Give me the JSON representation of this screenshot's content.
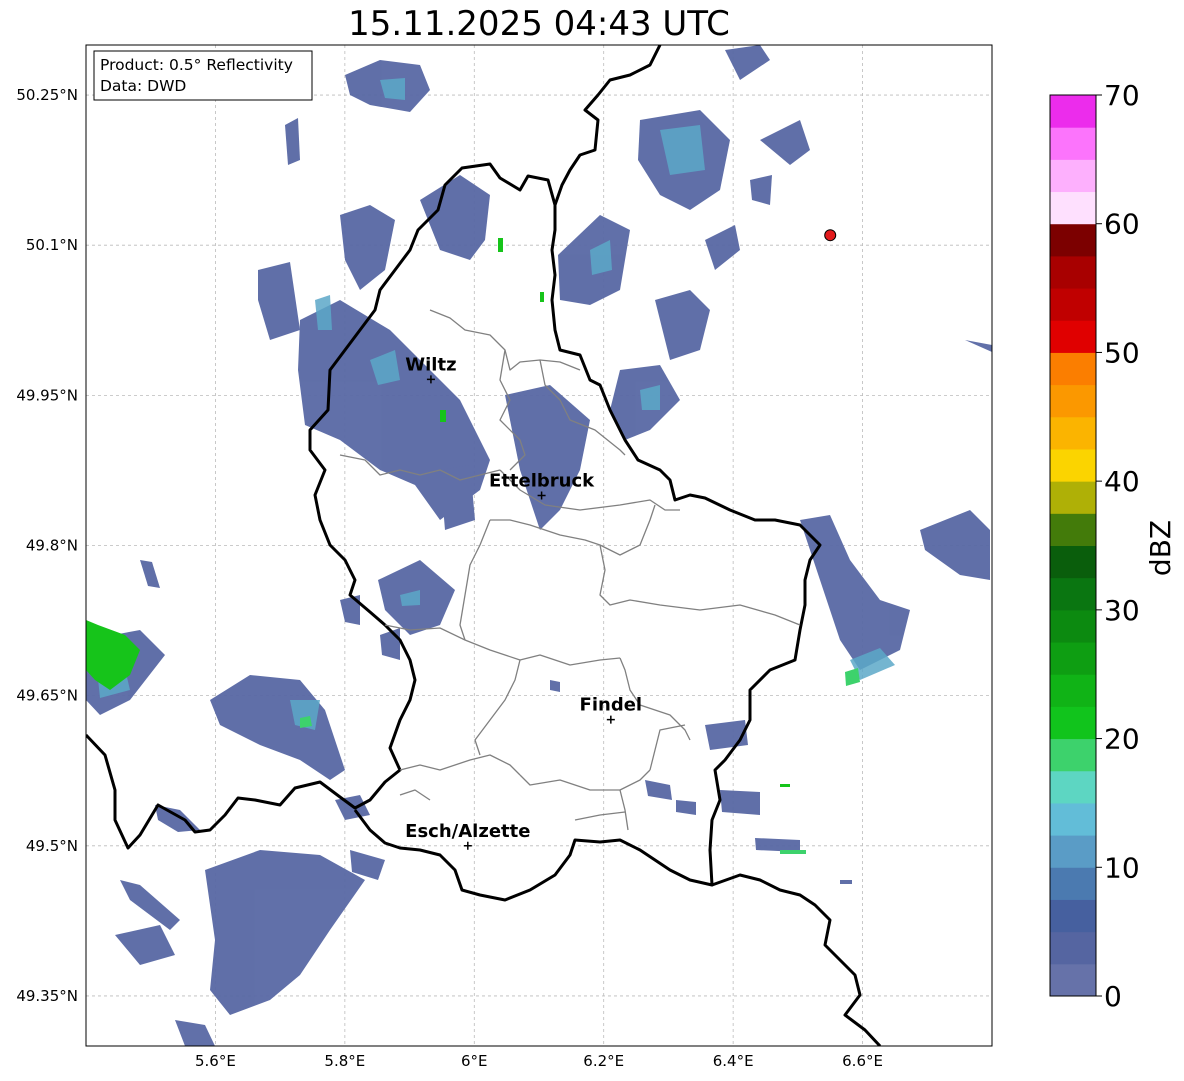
{
  "title": "15.11.2025 04:43 UTC",
  "info_box": {
    "line1": "Product: 0.5° Reflectivity",
    "line2": "Data: DWD"
  },
  "axes": {
    "lon_ticks": [
      "5.6°E",
      "5.8°E",
      "6°E",
      "6.2°E",
      "6.4°E",
      "6.6°E"
    ],
    "lat_ticks": [
      "50.25°N",
      "50.1°N",
      "49.95°N",
      "49.8°N",
      "49.65°N",
      "49.5°N",
      "49.35°N"
    ]
  },
  "cities": [
    {
      "name": "Wiltz",
      "lon": 5.933,
      "lat": 49.966
    },
    {
      "name": "Ettelbruck",
      "lon": 6.104,
      "lat": 49.85
    },
    {
      "name": "Findel",
      "lon": 6.211,
      "lat": 49.626
    },
    {
      "name": "Esch/Alzette",
      "lon": 5.99,
      "lat": 49.5
    }
  ],
  "marker": {
    "lon": 6.55,
    "lat": 50.11,
    "color": "#e31a1c"
  },
  "colorbar": {
    "label": "dBZ",
    "ticks": [
      "0",
      "10",
      "20",
      "30",
      "40",
      "50",
      "60",
      "70"
    ],
    "min": 0,
    "max": 70,
    "step": 2.5,
    "colors": [
      "#6672a9",
      "#5565a1",
      "#46609f",
      "#4b7ab0",
      "#5a9cc6",
      "#62bdd8",
      "#5dd6c2",
      "#3dd26c",
      "#11c41c",
      "#10b316",
      "#0e9e12",
      "#0c8a10",
      "#0a7611",
      "#0a5e0c",
      "#437b0a",
      "#afb006",
      "#fbd400",
      "#fbb400",
      "#fb9800",
      "#fb7e00",
      "#e00000",
      "#c00000",
      "#a80000",
      "#7c0000",
      "#fee0fe",
      "#fdb0fd",
      "#fc74fc",
      "#ec2cec"
    ]
  },
  "colors": {
    "border_thick": "#000000",
    "border_thin": "#808080",
    "grid": "#bbbbbb"
  }
}
